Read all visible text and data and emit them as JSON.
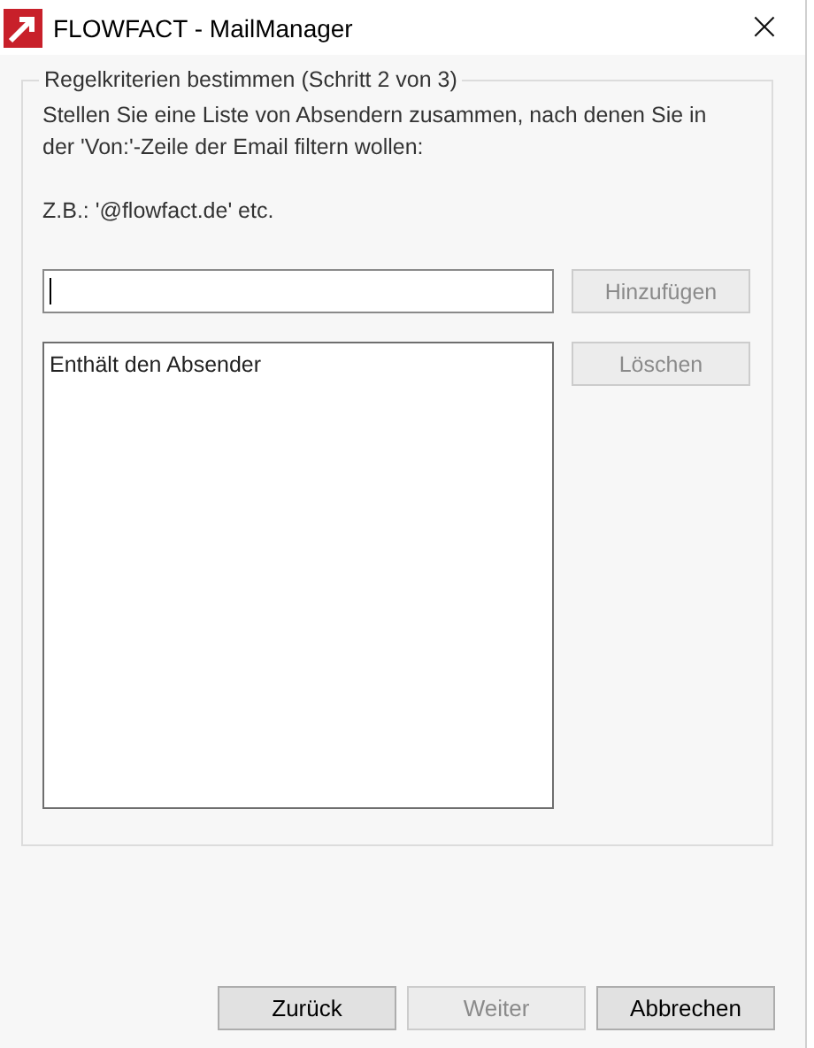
{
  "window": {
    "title": "FLOWFACT - MailManager",
    "close": "×"
  },
  "group": {
    "title": "Regelkriterien bestimmen (Schritt 2 von 3)",
    "instructions": [
      "Stellen Sie eine Liste von Absendern zusammen, nach denen Sie in der 'Von:'-Zeile der Email filtern wollen:",
      "Z.B.: '@flowfact.de' etc."
    ],
    "sender_input": {
      "focused": true
    },
    "add_button": {
      "label": "Hinzufügen",
      "disabled": true
    },
    "list": {
      "header": "Enthält den Absender"
    },
    "delete_button": {
      "label": "Löschen",
      "disabled": true
    }
  },
  "buttons": [
    {
      "label": "Zurück",
      "disabled": false
    },
    {
      "label": "Weiter",
      "disabled": true
    },
    {
      "label": "Abbrechen",
      "disabled": false
    }
  ]
}
